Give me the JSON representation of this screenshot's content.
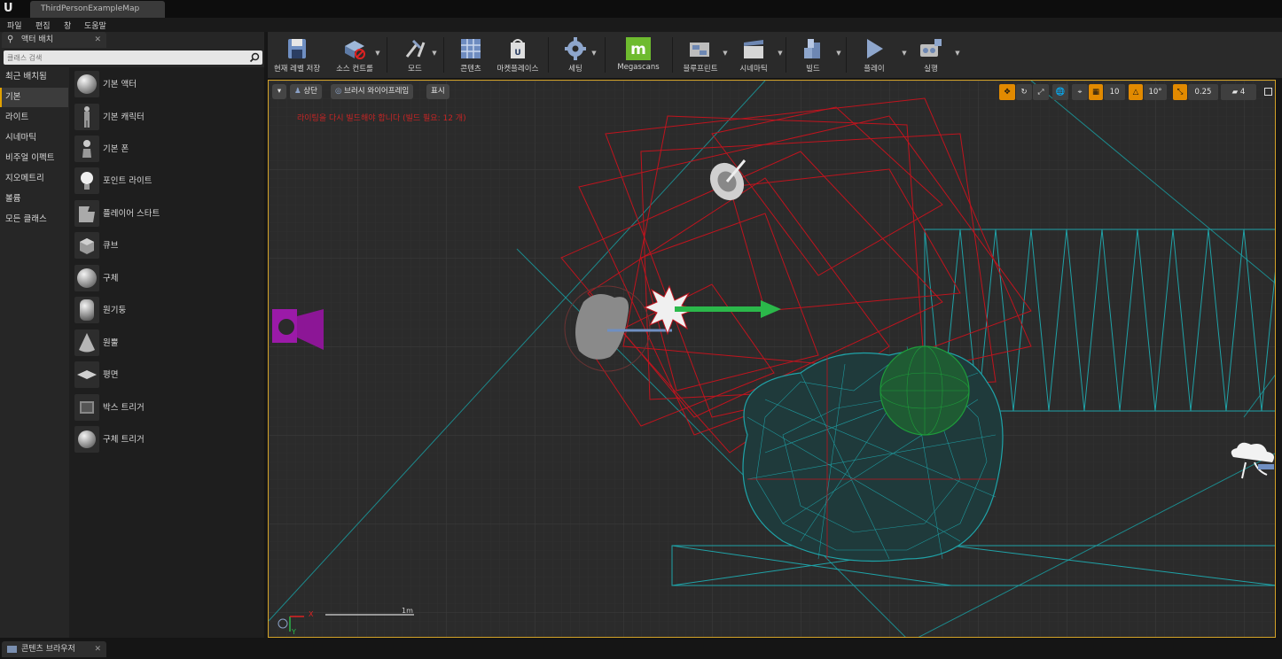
{
  "window": {
    "doc_tab": "ThirdPersonExampleMap"
  },
  "menubar": {
    "items": [
      "파일",
      "편집",
      "창",
      "도움말"
    ]
  },
  "left_panel": {
    "tab_title": "액터 배치",
    "search_placeholder": "클래스 검색",
    "categories": [
      "최근 배치됨",
      "기본",
      "라이트",
      "시네마틱",
      "비주얼 이펙트",
      "지오메트리",
      "볼륨",
      "모든 클래스"
    ],
    "active_category": "기본",
    "items": [
      "기본 액터",
      "기본 캐릭터",
      "기본 폰",
      "포인트 라이트",
      "플레이어 스타트",
      "큐브",
      "구체",
      "원기둥",
      "원뿔",
      "평면",
      "박스 트리거",
      "구체 트리거"
    ]
  },
  "toolbar": {
    "buttons": [
      "현재 레벨 저장",
      "소스 컨트롤",
      "모드",
      "콘텐츠",
      "마켓플레이스",
      "세팅",
      "Megascans",
      "블루프린트",
      "시네마틱",
      "빌드",
      "플레이",
      "실행"
    ]
  },
  "viewport": {
    "view_mode": "상단",
    "render_mode": "브러시 와이어프레임",
    "show_label": "표시",
    "warning": "라이팅을 다시 빌드해야 합니다 (빌드 필요: 12 개)",
    "grid_snap": "10",
    "rotation_snap": "10°",
    "scale_snap": "0.25",
    "camera_speed": "4",
    "scale_label": "1m",
    "axis_x": "X",
    "axis_y": "Y"
  },
  "bottom": {
    "content_browser_tab": "콘텐츠 브라우저"
  },
  "colors": {
    "accent": "#d3a227",
    "warning": "#c72525",
    "wire_red": "#c0141e",
    "wire_cyan": "#1fa3a8",
    "wire_green": "#1e9c3a",
    "snap_orange": "#e28a00"
  }
}
